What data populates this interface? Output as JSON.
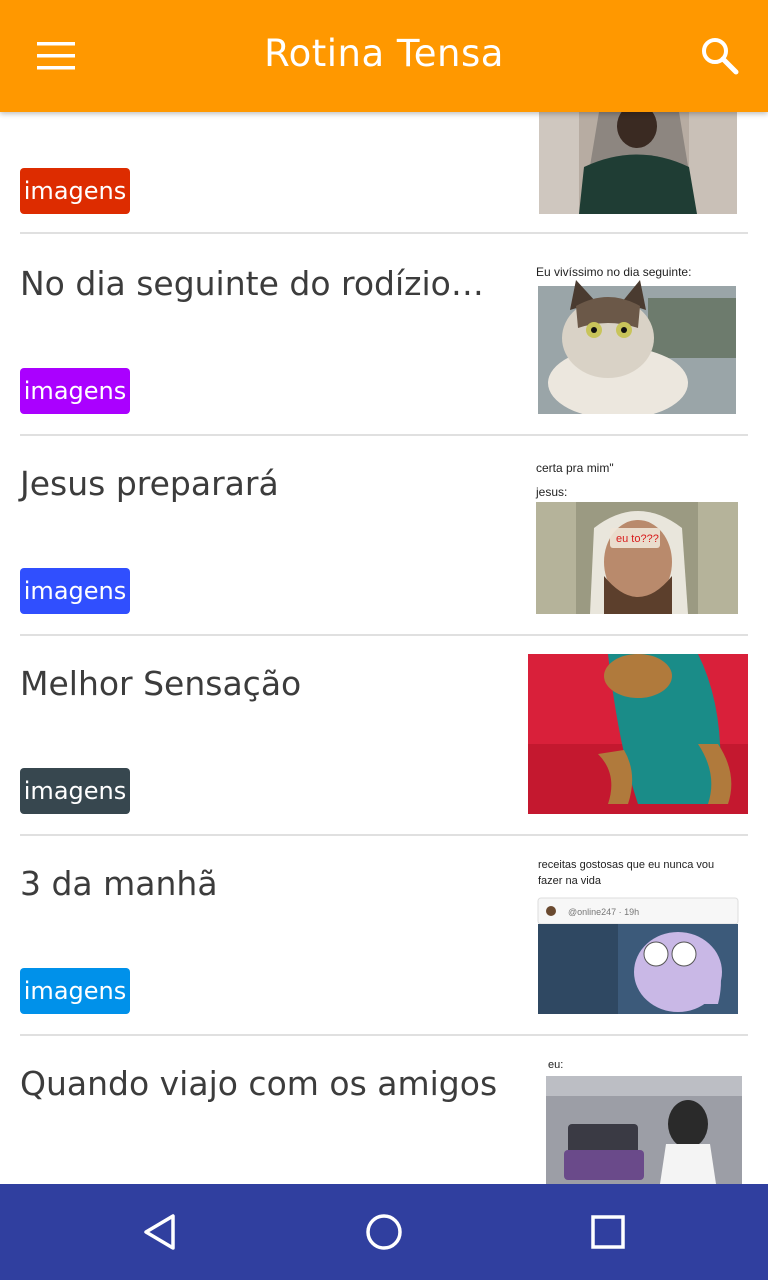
{
  "app": {
    "title": "Rotina Tensa",
    "menu_icon": "hamburger-menu-icon",
    "search_icon": "search-icon",
    "bar_color": "#ff9800"
  },
  "posts": [
    {
      "title": "",
      "tag": "imagens",
      "tag_color": "#dd2c00",
      "thumb": "man-green-sweater-chair"
    },
    {
      "title": "No dia seguinte do rodízio…",
      "tag": "imagens",
      "tag_color": "#aa00ff",
      "thumb": "fat-cat-meme",
      "thumb_caption": "Eu vivíssimo no dia seguinte:"
    },
    {
      "title": "Jesus preparará",
      "tag": "imagens",
      "tag_color": "#304ffe",
      "thumb": "jesus-meme",
      "thumb_caption_1": "certa pra mim\"",
      "thumb_caption_2": "jesus:",
      "thumb_overlay": "eu to???"
    },
    {
      "title": "Melhor Sensação",
      "tag": "imagens",
      "tag_color": "#37474f",
      "thumb": "dog-on-red-couch"
    },
    {
      "title": "3 da manhã",
      "tag": "imagens",
      "tag_color": "#0091ea",
      "thumb": "cartoon-meme",
      "thumb_caption": "receitas gostosas que eu nunca vou fazer na vida",
      "thumb_handle": "@online247 · 19h"
    },
    {
      "title": "Quando viajo com os amigos",
      "tag": "",
      "tag_color": "#000000",
      "thumb": "luggage-elevator-meme",
      "thumb_caption": "eu:"
    }
  ],
  "navbar": {
    "back_icon": "back-triangle-icon",
    "home_icon": "home-circle-icon",
    "recents_icon": "recents-square-icon",
    "bar_color": "#303f9f"
  }
}
